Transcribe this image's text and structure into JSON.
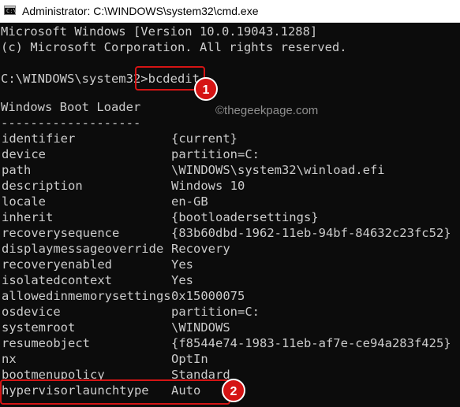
{
  "window": {
    "title": "Administrator: C:\\WINDOWS\\system32\\cmd.exe",
    "icon": "cmd-icon"
  },
  "console": {
    "header": [
      "Microsoft Windows [Version 10.0.19043.1288]",
      "(c) Microsoft Corporation. All rights reserved."
    ],
    "prompt": "C:\\WINDOWS\\system32>",
    "command": "bcdedit",
    "section_title": "Windows Boot Loader",
    "separator": "-------------------",
    "entries": [
      {
        "key": "identifier",
        "value": "{current}"
      },
      {
        "key": "device",
        "value": "partition=C:"
      },
      {
        "key": "path",
        "value": "\\WINDOWS\\system32\\winload.efi"
      },
      {
        "key": "description",
        "value": "Windows 10"
      },
      {
        "key": "locale",
        "value": "en-GB"
      },
      {
        "key": "inherit",
        "value": "{bootloadersettings}"
      },
      {
        "key": "recoverysequence",
        "value": "{83b60dbd-1962-11eb-94bf-84632c23fc52}"
      },
      {
        "key": "displaymessageoverride",
        "value": "Recovery"
      },
      {
        "key": "recoveryenabled",
        "value": "Yes"
      },
      {
        "key": "isolatedcontext",
        "value": "Yes"
      },
      {
        "key": "allowedinmemorysettings",
        "value": "0x15000075"
      },
      {
        "key": "osdevice",
        "value": "partition=C:"
      },
      {
        "key": "systemroot",
        "value": "\\WINDOWS"
      },
      {
        "key": "resumeobject",
        "value": "{f8544e74-1983-11eb-af7e-ce94a283f425}"
      },
      {
        "key": "nx",
        "value": "OptIn"
      },
      {
        "key": "bootmenupolicy",
        "value": "Standard"
      },
      {
        "key": "hypervisorlaunchtype",
        "value": "Auto"
      }
    ]
  },
  "annotations": {
    "badge_1": "1",
    "badge_2": "2",
    "color": "#d51414"
  },
  "watermark": "©thegeekpage.com"
}
